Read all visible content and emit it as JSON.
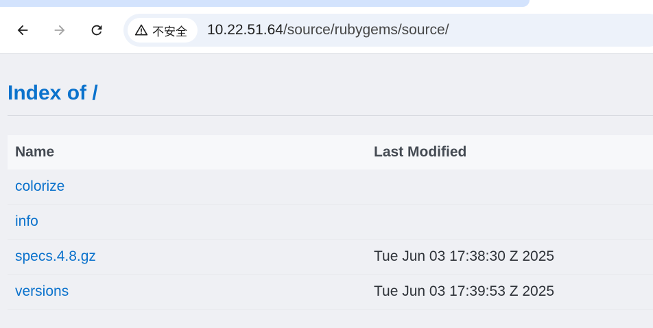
{
  "browser": {
    "security_label": "不安全",
    "url_host": "10.22.51.64",
    "url_path": "/source/rubygems/source/",
    "icons": {
      "back": "back-arrow-icon",
      "forward": "forward-arrow-icon",
      "reload": "reload-icon",
      "security": "warning-triangle-icon"
    }
  },
  "page": {
    "title": "Index of /",
    "columns": {
      "name": "Name",
      "modified": "Last Modified"
    },
    "entries": [
      {
        "name": "colorize",
        "modified": ""
      },
      {
        "name": "info",
        "modified": ""
      },
      {
        "name": "specs.4.8.gz",
        "modified": "Tue Jun 03 17:38:30 Z 2025"
      },
      {
        "name": "versions",
        "modified": "Tue Jun 03 17:39:53 Z 2025"
      }
    ]
  },
  "colors": {
    "link": "#0b72cc",
    "page_background": "#eff0f4",
    "omnibox": "#edf2fa"
  }
}
